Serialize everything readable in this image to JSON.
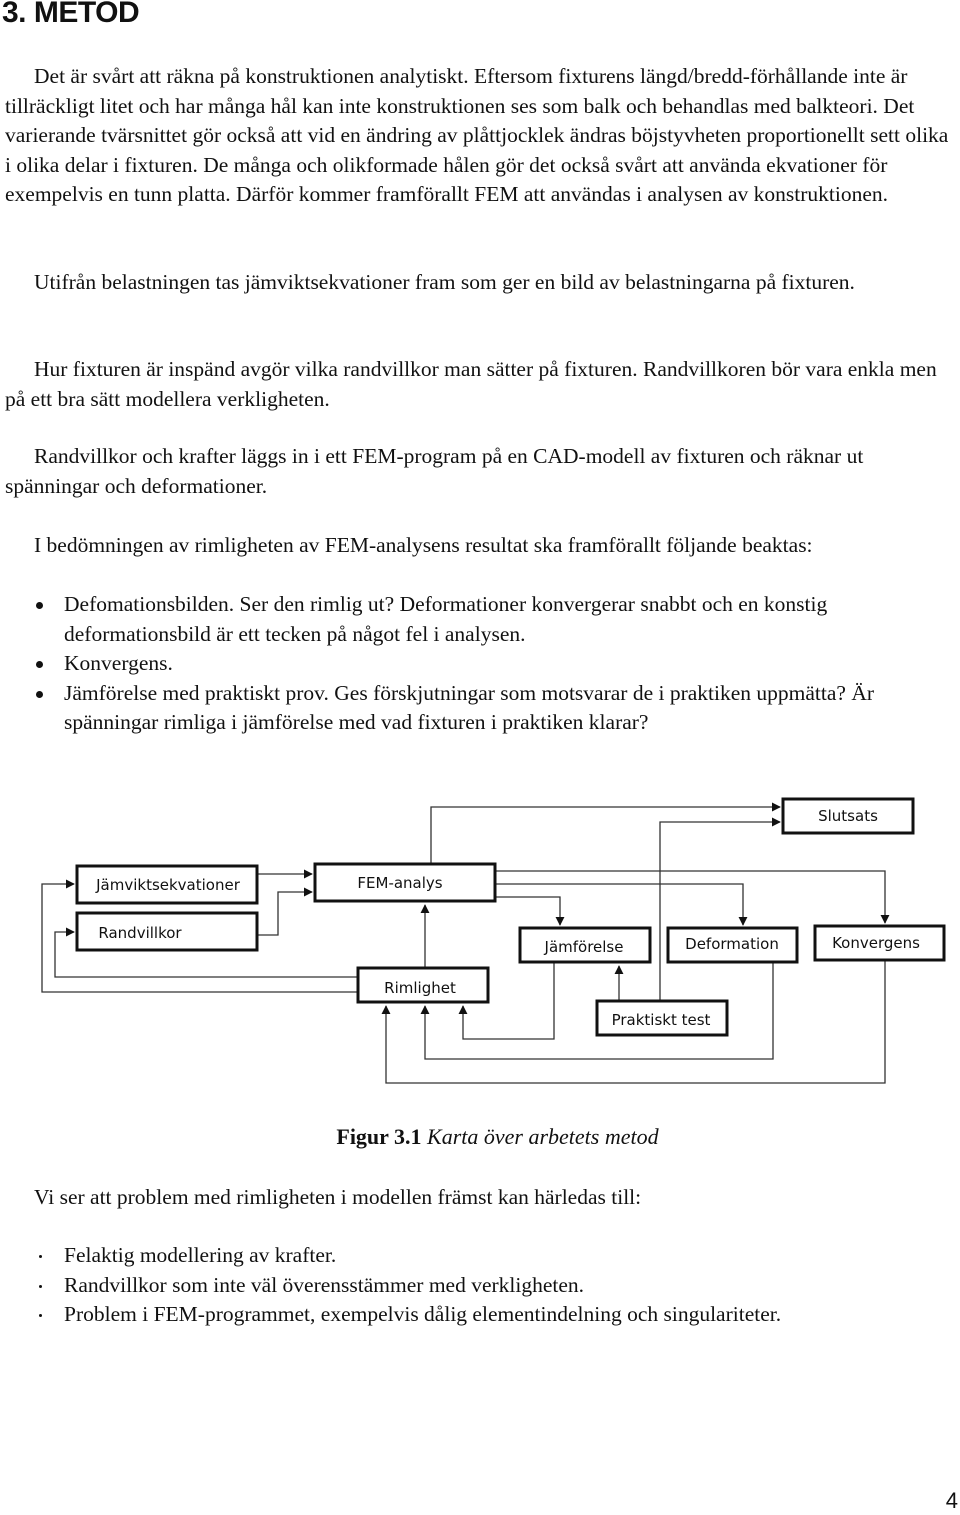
{
  "heading": "3. METOD",
  "paragraphs": {
    "p1": "Det är svårt att räkna på konstruktionen analytiskt. Eftersom fixturens längd/bredd-förhållande inte är tillräckligt litet och har många hål kan inte konstruktionen ses som balk och behandlas med balkteori. Det varierande tvärsnittet gör också att vid en ändring av plåttjocklek ändras böjstyvheten proportionellt sett olika i olika delar i fixturen.  De många och olikformade hålen gör det också svårt att använda ekvationer för exempelvis en tunn platta. Därför kommer framförallt FEM att användas i analysen av konstruktionen.",
    "p2": "Utifrån belastningen tas jämviktsekvationer fram som ger en bild av belastningarna på fixturen.",
    "p3": "Hur fixturen är inspänd avgör vilka randvillkor man sätter på fixturen. Randvillkoren bör vara enkla men på ett bra sätt modellera verkligheten.",
    "p4": "Randvillkor och krafter läggs in i ett FEM-program på en CAD-modell av fixturen och räknar ut spänningar och deformationer.",
    "p5": "I bedömningen av rimligheten av FEM-analysens resultat ska framförallt följande beaktas:",
    "p6": "Vi ser att problem med rimligheten i modellen främst kan härledas till:"
  },
  "criteria_list": [
    "Defomationsbilden. Ser den rimlig ut? Deformationer konvergerar snabbt och en konstig deformationsbild är ett tecken på något fel i analysen.",
    "Konvergens.",
    "Jämförelse med praktiskt prov. Ges förskjutningar som motsvarar de i praktiken uppmätta? Är spänningar rimliga i jämförelse med vad fixturen i praktiken klarar?"
  ],
  "problems_list": [
    "Felaktig modellering av krafter.",
    "Randvillkor som inte väl överensstämmer med verkligheten.",
    "Problem i FEM-programmet, exempelvis dålig elementindelning och singulariteter."
  ],
  "diagram": {
    "nodes": {
      "slutsats": "Slutsats",
      "jamvikt": "Jämviktsekvationer",
      "fem": "FEM-analys",
      "randvillkor": "Randvillkor",
      "jamforelse": "Jämförelse",
      "deformation": "Deformation",
      "konvergens": "Konvergens",
      "rimlighet": "Rimlighet",
      "praktiskt": "Praktiskt test"
    },
    "edges": [
      [
        "Jämviktsekvationer",
        "FEM-analys"
      ],
      [
        "Randvillkor",
        "FEM-analys"
      ],
      [
        "FEM-analys",
        "Slutsats"
      ],
      [
        "FEM-analys",
        "Jämförelse"
      ],
      [
        "FEM-analys",
        "Deformation"
      ],
      [
        "FEM-analys",
        "Konvergens"
      ],
      [
        "Praktiskt test",
        "Jämförelse"
      ],
      [
        "Praktiskt test",
        "Slutsats"
      ],
      [
        "Jämförelse",
        "Rimlighet"
      ],
      [
        "Deformation",
        "Rimlighet"
      ],
      [
        "Konvergens",
        "Rimlighet"
      ],
      [
        "Rimlighet",
        "FEM-analys"
      ],
      [
        "Rimlighet",
        "Jämviktsekvationer"
      ],
      [
        "Rimlighet",
        "Randvillkor"
      ]
    ]
  },
  "caption": {
    "label": "Figur 3.1",
    "text": " Karta över arbetets metod"
  },
  "page_number": "4"
}
